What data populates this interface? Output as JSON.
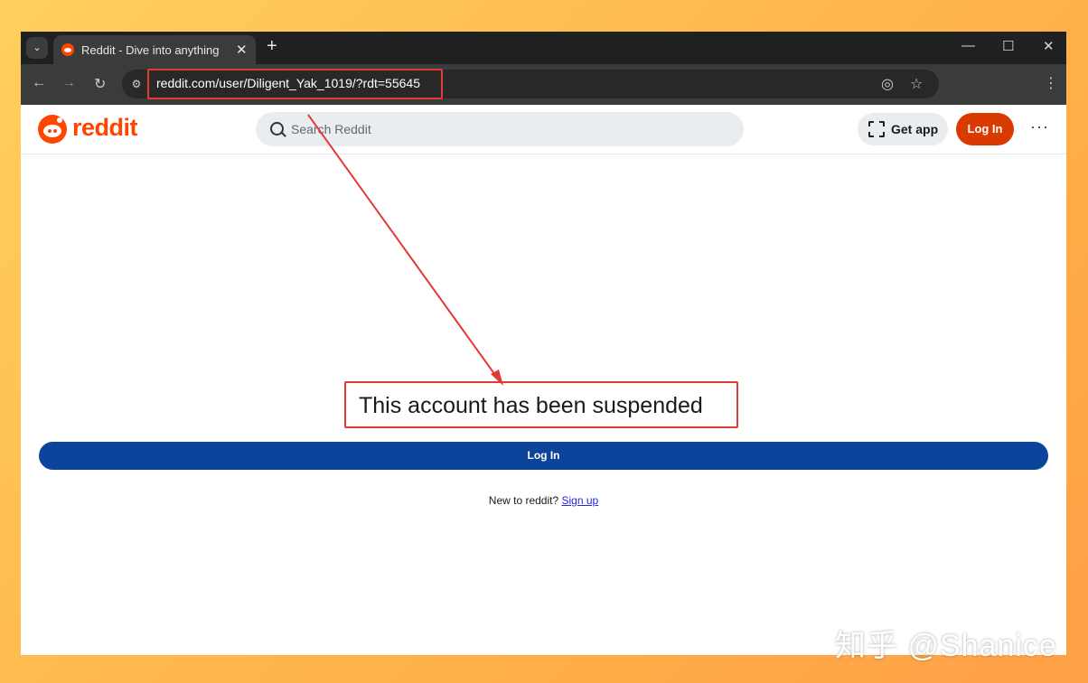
{
  "browser": {
    "tab_title": "Reddit - Dive into anything",
    "tab_close": "✕",
    "new_tab": "+",
    "url": "reddit.com/user/Diligent_Yak_1019/?rdt=55645"
  },
  "header": {
    "logo_text": "reddit",
    "search_placeholder": "Search Reddit",
    "get_app": "Get app",
    "login": "Log In"
  },
  "main": {
    "message": "This account has been suspended",
    "login_button": "Log In",
    "new_text": "New to reddit? ",
    "signup_link": "Sign up"
  },
  "watermark": "知乎 @Shanice",
  "colors": {
    "brand": "#ff4500",
    "login_top": "#d93a00",
    "login_main": "#0b449a",
    "annotation": "#e53935"
  }
}
